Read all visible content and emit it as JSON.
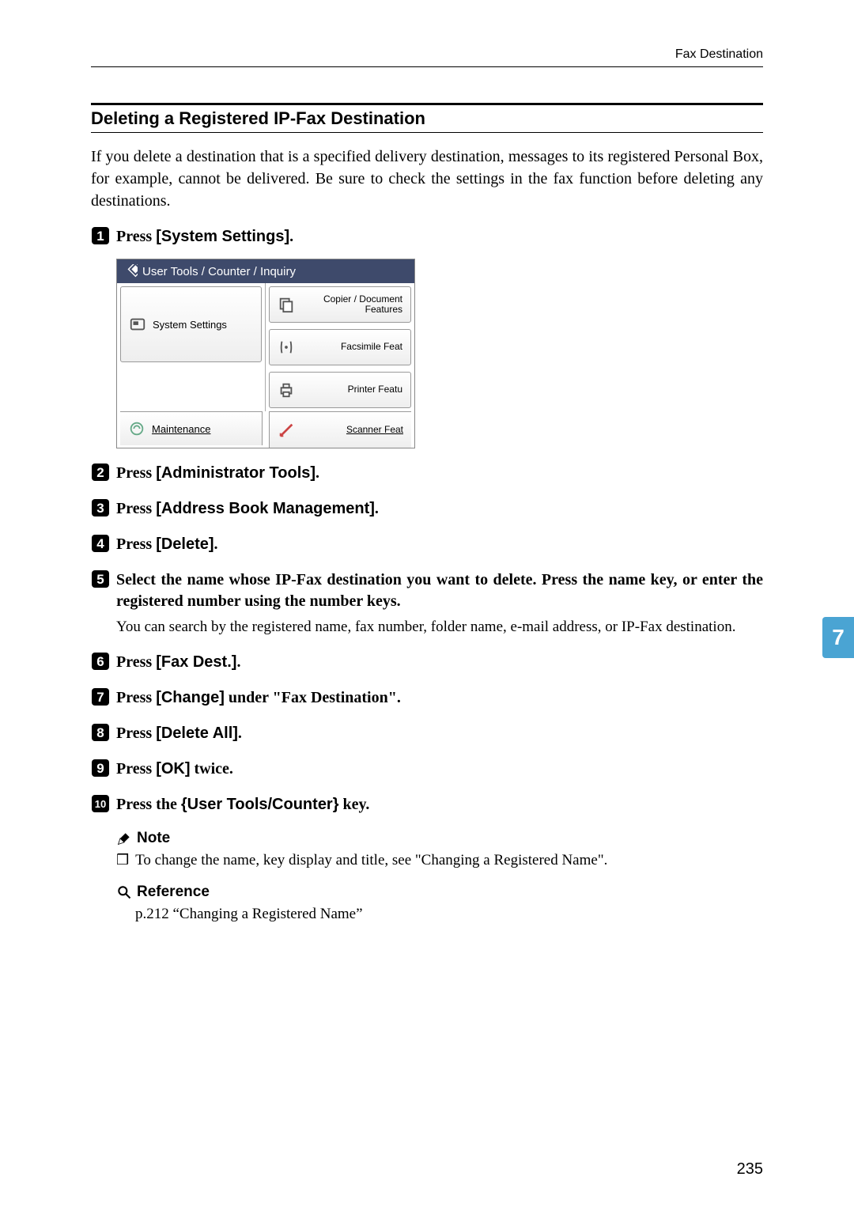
{
  "header": {
    "running": "Fax Destination"
  },
  "section": {
    "title": "Deleting a Registered IP-Fax Destination"
  },
  "intro": "If you delete a destination that is a specified delivery destination, messages to its registered Personal Box, for example, cannot be delivered. Be sure to check the settings in the fax function before deleting any destinations.",
  "steps": {
    "s1": {
      "prefix": "Press ",
      "ui": "[System Settings]",
      "suffix": "."
    },
    "s2": {
      "prefix": "Press ",
      "ui": "[Administrator Tools]",
      "suffix": "."
    },
    "s3": {
      "prefix": "Press ",
      "ui": "[Address Book Management]",
      "suffix": "."
    },
    "s4": {
      "prefix": "Press ",
      "ui": "[Delete]",
      "suffix": "."
    },
    "s5": {
      "text": "Select the name whose IP-Fax destination you want to delete. Press the name key, or enter the registered number using the number keys."
    },
    "s5_sub": "You can search by the registered name, fax number, folder name, e-mail address, or IP-Fax destination.",
    "s6": {
      "prefix": "Press ",
      "ui": "[Fax Dest.]",
      "suffix": "."
    },
    "s7": {
      "prefix": "Press ",
      "ui": "[Change]",
      "suffix": " under \"Fax Destination\"."
    },
    "s8": {
      "prefix": "Press ",
      "ui": "[Delete All]",
      "suffix": "."
    },
    "s9": {
      "prefix": "Press ",
      "ui": "[OK]",
      "suffix": " twice."
    },
    "s10": {
      "prefix": "Press the ",
      "key": "{User Tools/Counter}",
      "suffix": " key."
    }
  },
  "screenshot": {
    "header": "User Tools / Counter / Inquiry",
    "system_settings": "System Settings",
    "copier": "Copier / Document Features",
    "fax": "Facsimile Feat",
    "printer": "Printer Featu",
    "maintenance": "Maintenance",
    "scanner": "Scanner Feat"
  },
  "note": {
    "head": "Note",
    "item": "To change the name, key display and title, see \"Changing a Registered Name\"."
  },
  "reference": {
    "head": "Reference",
    "body": "p.212 “Changing a Registered Name”"
  },
  "sidetab": "7",
  "page": "235"
}
